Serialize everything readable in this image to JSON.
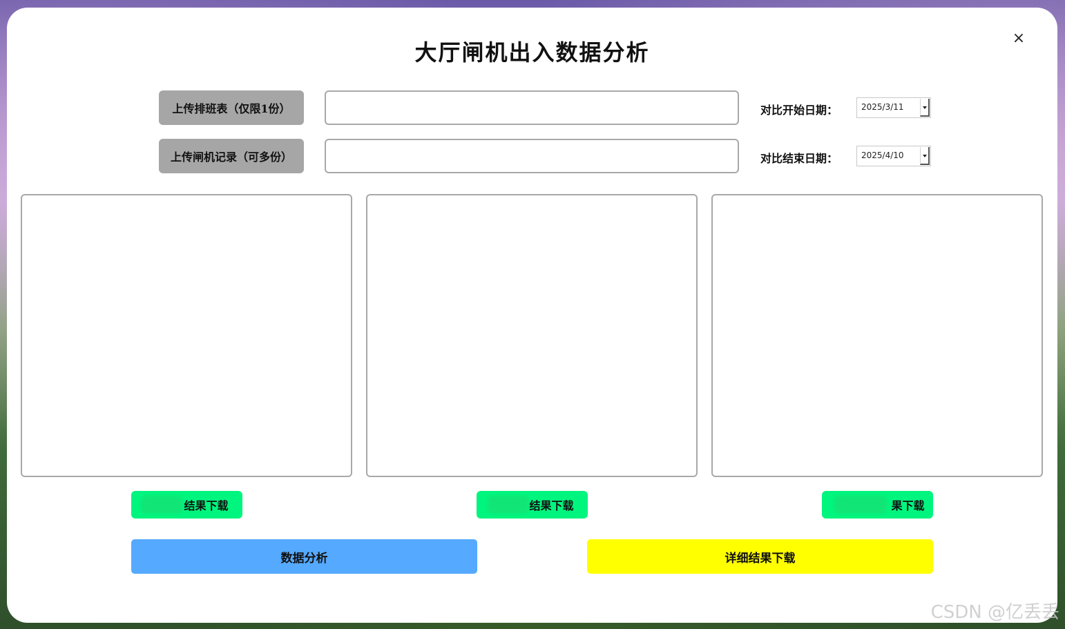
{
  "colors": {
    "upload_button": "#a6a6a6",
    "download_button": "#00f57e",
    "analyze_button": "#55aaff",
    "detail_download_button": "#ffff00",
    "panel_border": "#a8a8a8"
  },
  "window": {
    "title": "大厅闸机出入数据分析",
    "close_label": "×"
  },
  "upload": {
    "schedule_button": "上传排班表（仅限1份）",
    "gate_records_button": "上传闸机记录（可多份）",
    "schedule_path": "",
    "gate_records_path": ""
  },
  "dates": {
    "start_label": "对比开始日期：",
    "start_value": "2025/3/11",
    "end_label": "对比结束日期：",
    "end_value": "2025/4/10"
  },
  "results": {
    "download_buttons": [
      "结果下载",
      "结果下载",
      "果下载"
    ]
  },
  "actions": {
    "analyze_label": "数据分析",
    "detail_download_label": "详细结果下载"
  },
  "watermark": "CSDN @亿丢丢",
  "icons": {
    "close": "close-icon",
    "dropdown": "chevron-down-icon"
  }
}
